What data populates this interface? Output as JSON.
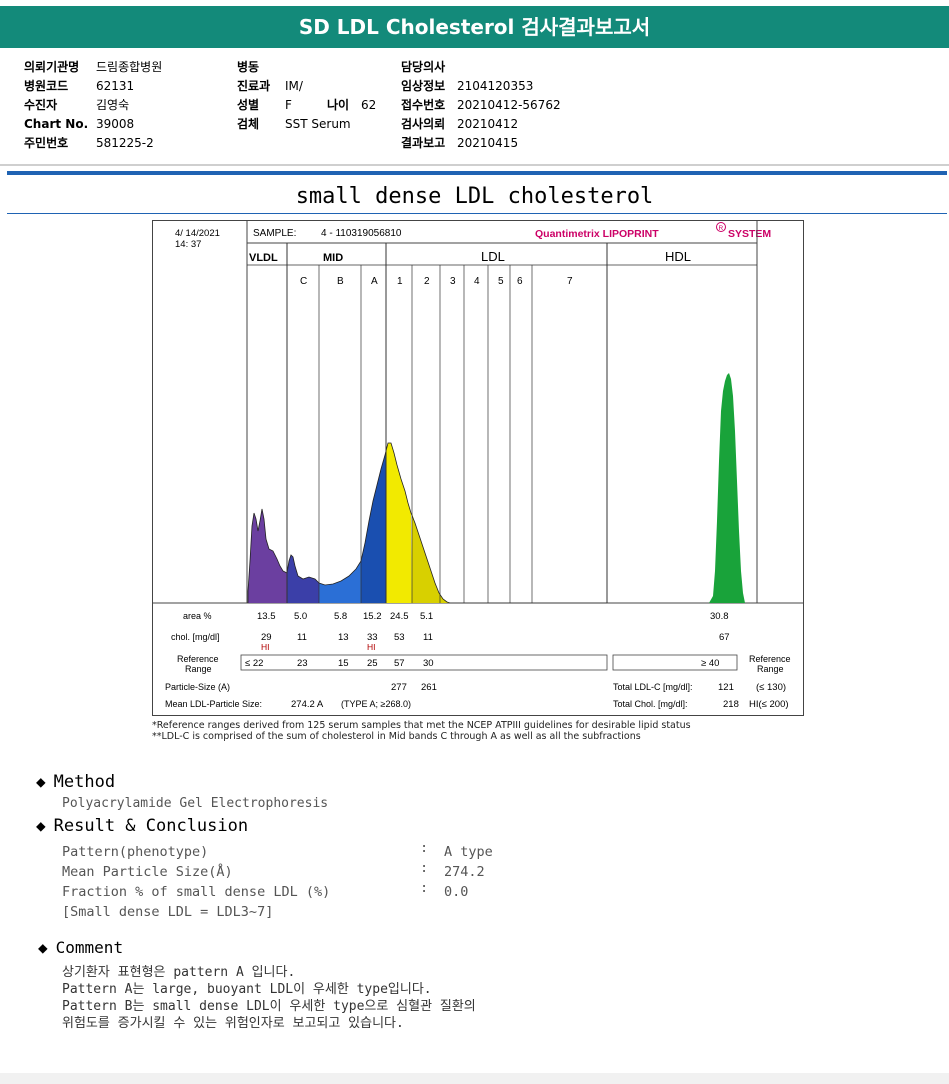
{
  "header": {
    "title": "SD LDL Cholesterol 검사결과보고서"
  },
  "patient": {
    "col1": [
      {
        "label": "의뢰기관명",
        "value": "드림종합병원"
      },
      {
        "label": "병원코드",
        "value": "62131"
      },
      {
        "label": "수진자",
        "value": "김영숙"
      },
      {
        "label": "Chart No.",
        "value": "39008"
      },
      {
        "label": "주민번호",
        "value": "581225-2"
      }
    ],
    "col2": [
      {
        "label": "병동",
        "value": ""
      },
      {
        "label": "진료과",
        "value": "IM/"
      },
      {
        "label": "성별",
        "value": "F"
      },
      {
        "label": "검체",
        "value": "SST Serum"
      }
    ],
    "age": {
      "label": "나이",
      "value": "62"
    },
    "col3": [
      {
        "label": "담당의사",
        "value": ""
      },
      {
        "label": "임상정보",
        "value": "2104120353"
      },
      {
        "label": "접수번호",
        "value": "20210412-56762"
      },
      {
        "label": "검사의뢰",
        "value": "20210412"
      },
      {
        "label": "결과보고",
        "value": "20210415"
      }
    ]
  },
  "subtitle": "small dense LDL cholesterol",
  "report": {
    "date": "4/ 14/2021",
    "time": "14: 37",
    "sample_label": "SAMPLE:",
    "sample_id": "4 - 110319056810",
    "brand": "Quantimetrix LIPOPRINT",
    "brand_tail": "SYSTEM",
    "brand_mark": "R",
    "groups": [
      "VLDL",
      "MID",
      "LDL",
      "HDL"
    ],
    "bands": [
      "C",
      "B",
      "A",
      "1",
      "2",
      "3",
      "4",
      "5",
      "6",
      "7"
    ],
    "row_labels": {
      "area": "area %",
      "chol": "chol. [mg/dl]",
      "reference": "Reference Range",
      "particle": "Particle-Size (A)",
      "mean": "Mean LDL-Particle Size:",
      "mean_value": "274.2 A",
      "mean_type": "(TYPE A; ≥268.0)",
      "ref_right": "Reference Range"
    },
    "area": [
      "13.5",
      "5.0",
      "5.8",
      "15.2",
      "24.5",
      "5.1",
      "30.8"
    ],
    "chol": [
      "29",
      "11",
      "13",
      "33",
      "53",
      "11",
      "67"
    ],
    "hi_flag": "HI",
    "reference": [
      "≤ 22",
      "23",
      "15",
      "25",
      "57",
      "30"
    ],
    "hdl_reference": "≥ 40",
    "particle_sizes": [
      "277",
      "261"
    ],
    "total_ldl_label": "Total LDL-C [mg/dl]:",
    "total_ldl_value": "121",
    "total_ldl_ref": "(≤ 130)",
    "total_chol_label": "Total Chol. [mg/dl]:",
    "total_chol_value": "218",
    "total_chol_ref": "HI(≤ 200)"
  },
  "footnotes": [
    "*Reference ranges derived from 125 serum samples that met the NCEP ATPIII guidelines for desirable lipid status",
    "**LDL-C is comprised of the sum of cholesterol in Mid bands C through A as well as all the subfractions"
  ],
  "method": {
    "heading": "Method",
    "text": "Polyacrylamide Gel Electrophoresis"
  },
  "result": {
    "heading": "Result & Conclusion",
    "rows": [
      {
        "label": "Pattern(phenotype)",
        "value": "A type"
      },
      {
        "label": "Mean Particle Size(Å)",
        "value": "274.2"
      },
      {
        "label": "Fraction % of small dense LDL (%)",
        "value": "0.0"
      }
    ],
    "note": "[Small dense LDL = LDL3~7]"
  },
  "comment": {
    "heading": "Comment",
    "lines": [
      "상기환자 표현형은 pattern A 입니다.",
      "Pattern A는 large, buoyant LDL이 우세한 type입니다.",
      "Pattern B는 small dense LDL이 우세한 type으로 심혈관 질환의",
      "위험도를 증가시킬 수 있는 위험인자로 보고되고 있습니다."
    ]
  },
  "colors": {
    "header_bg": "#138a7a",
    "accent_blue": "#1f63b3",
    "vldl": "#6b3fa0",
    "band_c": "#3b3fa8",
    "band_b": "#2b6fd6",
    "band_a": "#1a4fb0",
    "ldl1": "#f2ea00",
    "ldl2": "#d8d000",
    "hdl": "#19a33a",
    "brand": "#cc0066",
    "hi_flag": "#b00000"
  }
}
